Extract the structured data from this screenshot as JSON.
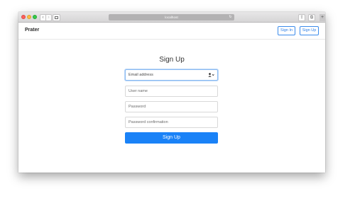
{
  "browser": {
    "address": "localhost",
    "back_glyph": "‹",
    "forward_glyph": "›",
    "reload_glyph": "↻",
    "share_glyph": "⇪",
    "tabs_glyph": "⧉",
    "plus_glyph": "+"
  },
  "navbar": {
    "brand": "Prater",
    "signin_label": "Sign In",
    "signup_label": "Sign Up"
  },
  "form": {
    "title": "Sign Up",
    "email_placeholder": "Email address",
    "username_placeholder": "User name",
    "password_placeholder": "Password",
    "confirm_placeholder": "Password confirmation",
    "submit_label": "Sign Up"
  },
  "colors": {
    "accent": "#1a82f7",
    "outline_accent": "#3b8beb"
  },
  "icons": {
    "autofill": "contact-card-icon"
  }
}
